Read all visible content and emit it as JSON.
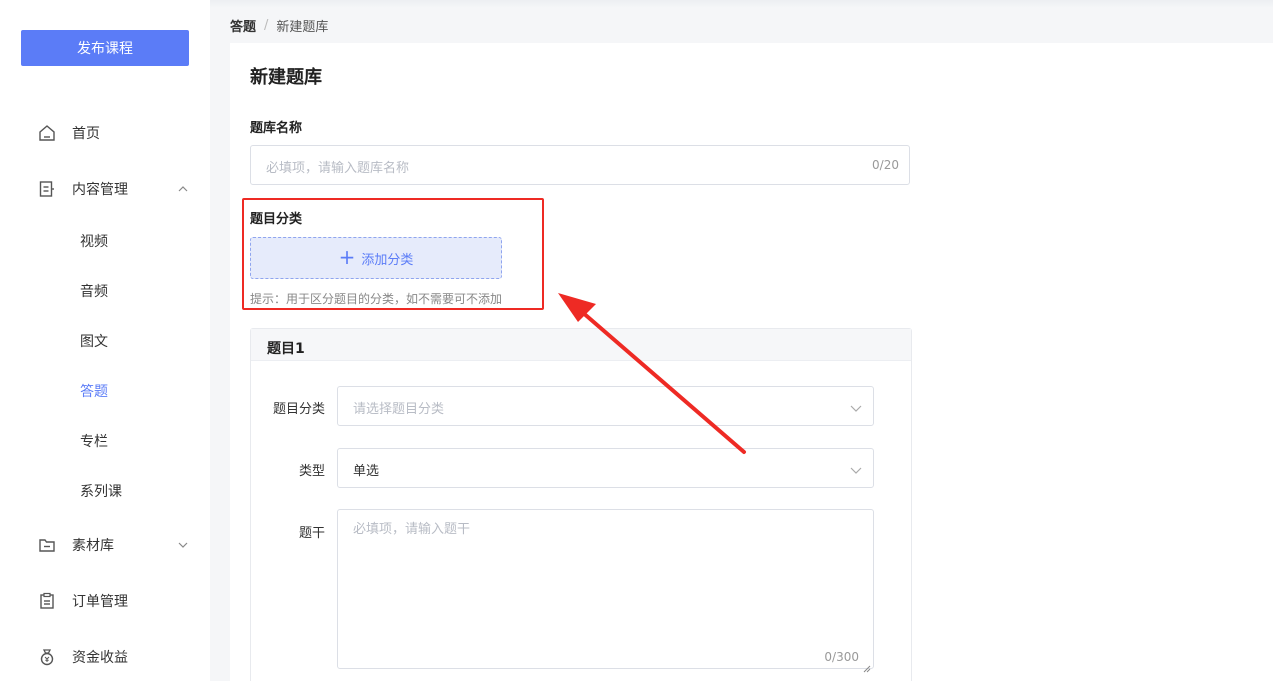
{
  "sidebar": {
    "publish_button": "发布课程",
    "nav": [
      {
        "label": "首页",
        "icon": "home-icon"
      },
      {
        "label": "内容管理",
        "icon": "document-icon",
        "expanded": true
      },
      {
        "label": "素材库",
        "icon": "folder-icon",
        "expanded": false
      },
      {
        "label": "订单管理",
        "icon": "clipboard-icon"
      },
      {
        "label": "资金收益",
        "icon": "money-bag-icon"
      }
    ],
    "content_sub": [
      "视频",
      "音频",
      "图文",
      "答题",
      "专栏",
      "系列课"
    ],
    "active_sub": "答题"
  },
  "breadcrumb": {
    "first": "答题",
    "separator": "/",
    "current": "新建题库"
  },
  "page": {
    "title": "新建题库",
    "bank_name": {
      "label": "题库名称",
      "placeholder": "必填项，请输入题库名称",
      "count": "0/20"
    },
    "category": {
      "label": "题目分类",
      "add_button": "添加分类",
      "hint": "提示：用于区分题目的分类，如不需要可不添加"
    },
    "question": {
      "title": "题目1",
      "category_label": "题目分类",
      "category_placeholder": "请选择题目分类",
      "type_label": "类型",
      "type_value": "单选",
      "stem_label": "题干",
      "stem_placeholder": "必填项，请输入题干",
      "stem_count": "0/300"
    }
  },
  "colors": {
    "accent": "#5b7cf7",
    "annotation": "#ee2a24"
  }
}
